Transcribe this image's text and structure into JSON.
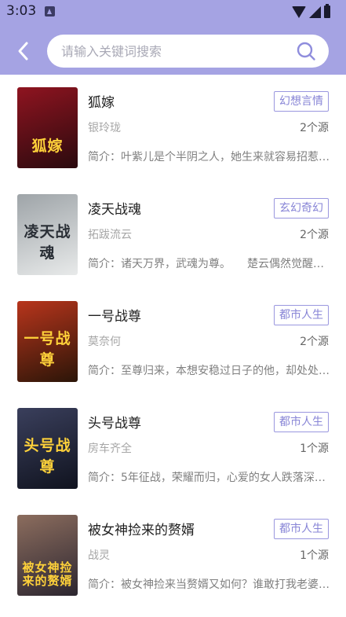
{
  "status_bar": {
    "time": "3:03"
  },
  "search": {
    "placeholder": "请输入关键词搜索",
    "value": ""
  },
  "books": [
    {
      "title": "狐嫁",
      "genre": "幻想言情",
      "author": "银玲珑",
      "sources": "2个源",
      "intro": "简介：叶紫儿是个半阴之人，她生来就容易招惹…",
      "cover_text": "狐嫁",
      "cover_colors": [
        "#2a0a0e",
        "#8f1420"
      ]
    },
    {
      "title": "凌天战魂",
      "genre": "玄幻奇幻",
      "author": "拓跋流云",
      "sources": "2个源",
      "intro": "简介：诸天万界，武魂为尊。　　楚云偶然觉醒…",
      "cover_text": "凌天战魂",
      "cover_colors": [
        "#e8eaea",
        "#9ea4a8"
      ]
    },
    {
      "title": "一号战尊",
      "genre": "都市人生",
      "author": "莫奈何",
      "sources": "2个源",
      "intro": "简介：至尊归来，本想安稳过日子的他，却处处…",
      "cover_text": "一号战尊",
      "cover_colors": [
        "#2b1508",
        "#b8351c"
      ]
    },
    {
      "title": "头号战尊",
      "genre": "都市人生",
      "author": "房车齐全",
      "sources": "1个源",
      "intro": "简介：5年征战，荣耀而归，心爱的女人跌落深…",
      "cover_text": "头号战尊",
      "cover_colors": [
        "#10131f",
        "#3a3f5c"
      ]
    },
    {
      "title": "被女神捡来的赘婿",
      "genre": "都市人生",
      "author": "战灵",
      "sources": "1个源",
      "intro": "简介：被女神捡来当赘婿又如何？谁敢打我老婆…",
      "cover_text": "被女神捡来的赘婿",
      "cover_colors": [
        "#2c2630",
        "#8c6d5e"
      ]
    }
  ]
}
